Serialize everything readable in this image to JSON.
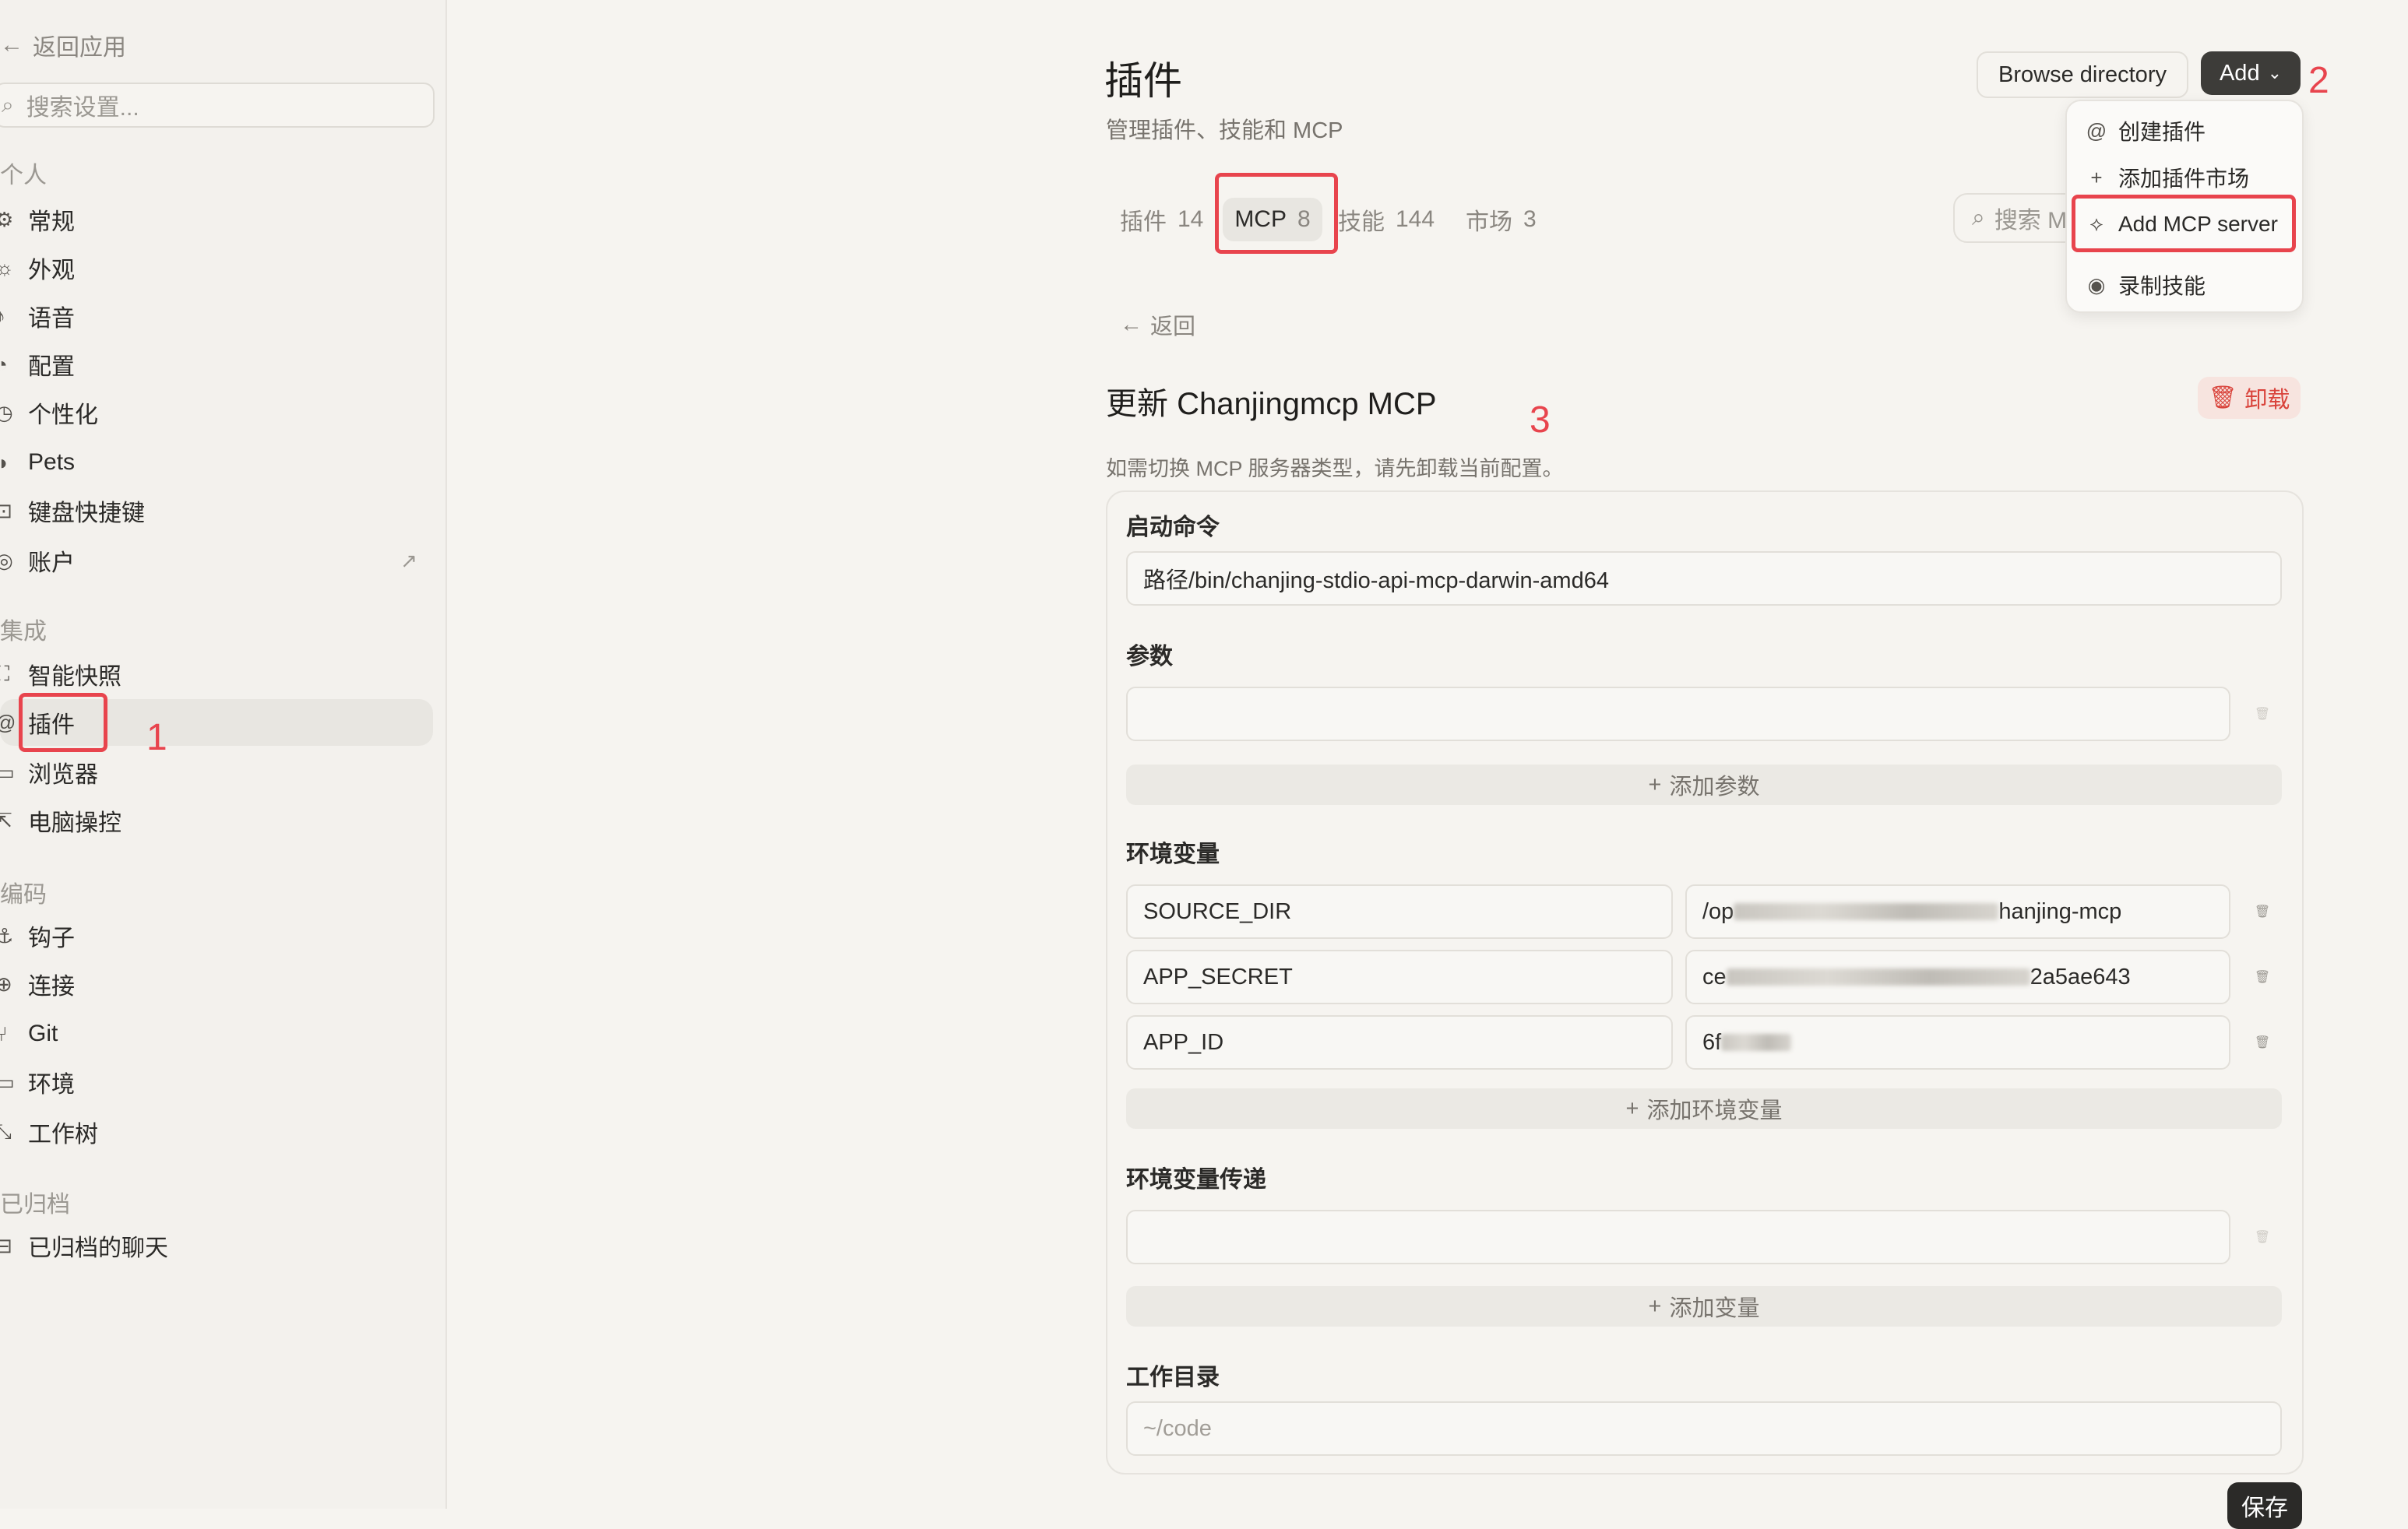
{
  "sidebar": {
    "back_label": "返回应用",
    "search_placeholder": "搜索设置...",
    "sections": {
      "personal": "个人",
      "integration": "集成",
      "coding": "编码",
      "archived": "已归档"
    },
    "items": {
      "general": "常规",
      "appearance": "外观",
      "voice": "语音",
      "config": "配置",
      "personalization": "个性化",
      "pets": "Pets",
      "shortcuts": "键盘快捷键",
      "account": "账户",
      "smart_snapshot": "智能快照",
      "plugins": "插件",
      "browser": "浏览器",
      "computer_control": "电脑操控",
      "hooks": "钩子",
      "connections": "连接",
      "git": "Git",
      "environment": "环境",
      "worktree": "工作树",
      "archived_chats": "已归档的聊天"
    }
  },
  "header": {
    "title": "插件",
    "subtitle": "管理插件、技能和 MCP",
    "browse_label": "Browse directory",
    "add_label": "Add"
  },
  "tabs": [
    {
      "label": "插件",
      "count": "14"
    },
    {
      "label": "MCP",
      "count": "8"
    },
    {
      "label": "技能",
      "count": "144"
    },
    {
      "label": "市场",
      "count": "3"
    }
  ],
  "tab_search_placeholder": "搜索 M",
  "dropdown": {
    "create_plugin": "创建插件",
    "add_marketplace": "添加插件市场",
    "add_mcp_server": "Add MCP server",
    "record_skill": "录制技能"
  },
  "detail": {
    "back_label": "返回",
    "title": "更新 Chanjingmcp MCP",
    "uninstall_label": "卸载",
    "hint": "如需切换 MCP 服务器类型，请先卸载当前配置。",
    "command_label": "启动命令",
    "command_value": "路径/bin/chanjing-stdio-api-mcp-darwin-amd64",
    "args_label": "参数",
    "add_arg_label": "添加参数",
    "env_label": "环境变量",
    "env_rows": [
      {
        "key": "SOURCE_DIR",
        "value_prefix": "/op",
        "value_suffix": "hanjing-mcp"
      },
      {
        "key": "APP_SECRET",
        "value_prefix": "ce",
        "value_suffix": "2a5ae643"
      },
      {
        "key": "APP_ID",
        "value_prefix": "6f",
        "value_suffix": ""
      }
    ],
    "add_env_label": "添加环境变量",
    "passthrough_label": "环境变量传递",
    "add_var_label": "添加变量",
    "workdir_label": "工作目录",
    "workdir_placeholder": "~/code",
    "save_label": "保存"
  },
  "annotations": [
    "1",
    "2",
    "3"
  ],
  "colors": {
    "background": "#f6f4f0",
    "sidebar": "#f3f1ed",
    "annotation_red": "#e8444d",
    "danger": "#d9433b",
    "dark_button": "#3d3c39"
  }
}
